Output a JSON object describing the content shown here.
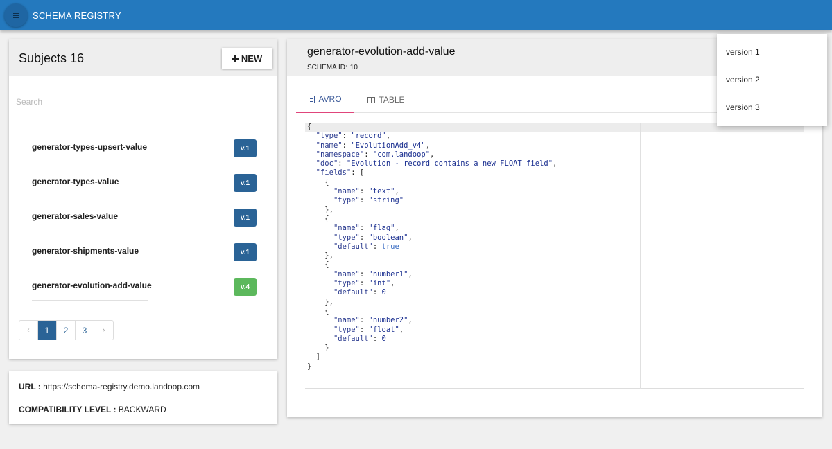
{
  "app": {
    "title": "SCHEMA REGISTRY"
  },
  "subjects": {
    "title": "Subjects 16",
    "new_label": "NEW",
    "search_placeholder": "Search",
    "items": [
      {
        "name": "generator-types-upsert-value",
        "version": "v.1"
      },
      {
        "name": "generator-types-value",
        "version": "v.1"
      },
      {
        "name": "generator-sales-value",
        "version": "v.1"
      },
      {
        "name": "generator-shipments-value",
        "version": "v.1"
      },
      {
        "name": "generator-evolution-add-value",
        "version": "v.4"
      }
    ],
    "pagination": {
      "prev": "‹",
      "pages": [
        "1",
        "2",
        "3"
      ],
      "next": "›",
      "current": "1"
    }
  },
  "info": {
    "url_label": "URL :",
    "url_value": "https://schema-registry.demo.landoop.com",
    "compat_label": "COMPATIBILITY LEVEL :",
    "compat_value": "BACKWARD"
  },
  "schema": {
    "title": "generator-evolution-add-value",
    "id_label": "SCHEMA ID:",
    "id_value": "10",
    "tabs": [
      {
        "label": "AVRO"
      },
      {
        "label": "TABLE"
      }
    ],
    "code_lines": [
      "{",
      "  \"type\": \"record\",",
      "  \"name\": \"EvolutionAdd_v4\",",
      "  \"namespace\": \"com.landoop\",",
      "  \"doc\": \"Evolution - record contains a new FLOAT field\",",
      "  \"fields\": [",
      "    {",
      "      \"name\": \"text\",",
      "      \"type\": \"string\"",
      "    },",
      "    {",
      "      \"name\": \"flag\",",
      "      \"type\": \"boolean\",",
      "      \"default\": true",
      "    },",
      "    {",
      "      \"name\": \"number1\",",
      "      \"type\": \"int\",",
      "      \"default\": 0",
      "    },",
      "    {",
      "      \"name\": \"number2\",",
      "      \"type\": \"float\",",
      "      \"default\": 0",
      "    }",
      "  ]",
      "}"
    ]
  },
  "version_menu": {
    "items": [
      "version 1",
      "version 2",
      "version 3"
    ]
  }
}
